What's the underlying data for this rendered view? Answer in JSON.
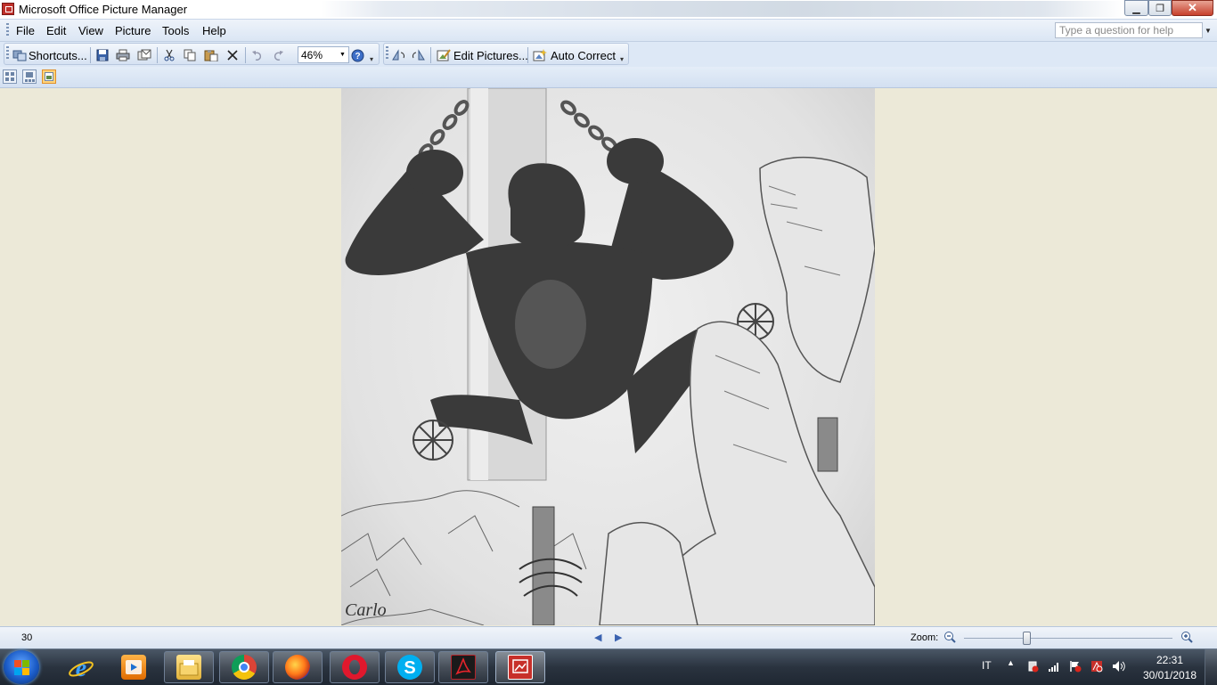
{
  "window": {
    "title": "Microsoft Office Picture Manager"
  },
  "menu": {
    "items": [
      {
        "label": "File"
      },
      {
        "label": "Edit"
      },
      {
        "label": "View"
      },
      {
        "label": "Picture"
      },
      {
        "label": "Tools"
      },
      {
        "label": "Help"
      }
    ],
    "help_placeholder": "Type a question for help"
  },
  "toolbar": {
    "shortcuts_label": "Shortcuts...",
    "zoom_value": "46%",
    "edit_pictures_label": "Edit Pictures...",
    "auto_correct_label": "Auto Correct"
  },
  "picture": {
    "signature": "Carlo"
  },
  "status": {
    "count": "30",
    "zoom_label": "Zoom:",
    "zoom_level": 0.3
  },
  "taskbar": {
    "language": "IT",
    "time": "22:31",
    "date": "30/01/2018"
  }
}
